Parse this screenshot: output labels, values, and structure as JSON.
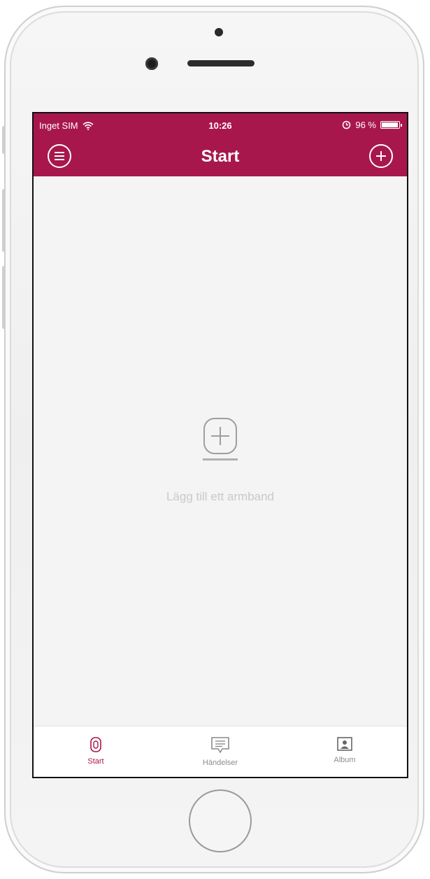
{
  "status_bar": {
    "carrier": "Inget SIM",
    "time": "10:26",
    "battery": "96 %",
    "battery_level": 0.96
  },
  "nav": {
    "title": "Start",
    "left_icon": "menu-icon",
    "right_icon": "add-icon"
  },
  "empty_state": {
    "icon": "add-device-icon",
    "message": "Lägg till ett armband"
  },
  "tabs": [
    {
      "label": "Start",
      "icon": "band-icon",
      "active": true
    },
    {
      "label": "Händelser",
      "icon": "message-icon",
      "active": false
    },
    {
      "label": "Album",
      "icon": "album-icon",
      "active": false
    }
  ],
  "colors": {
    "accent": "#a8174b",
    "background": "#f4f4f4",
    "inactive": "#8c8c8c"
  }
}
